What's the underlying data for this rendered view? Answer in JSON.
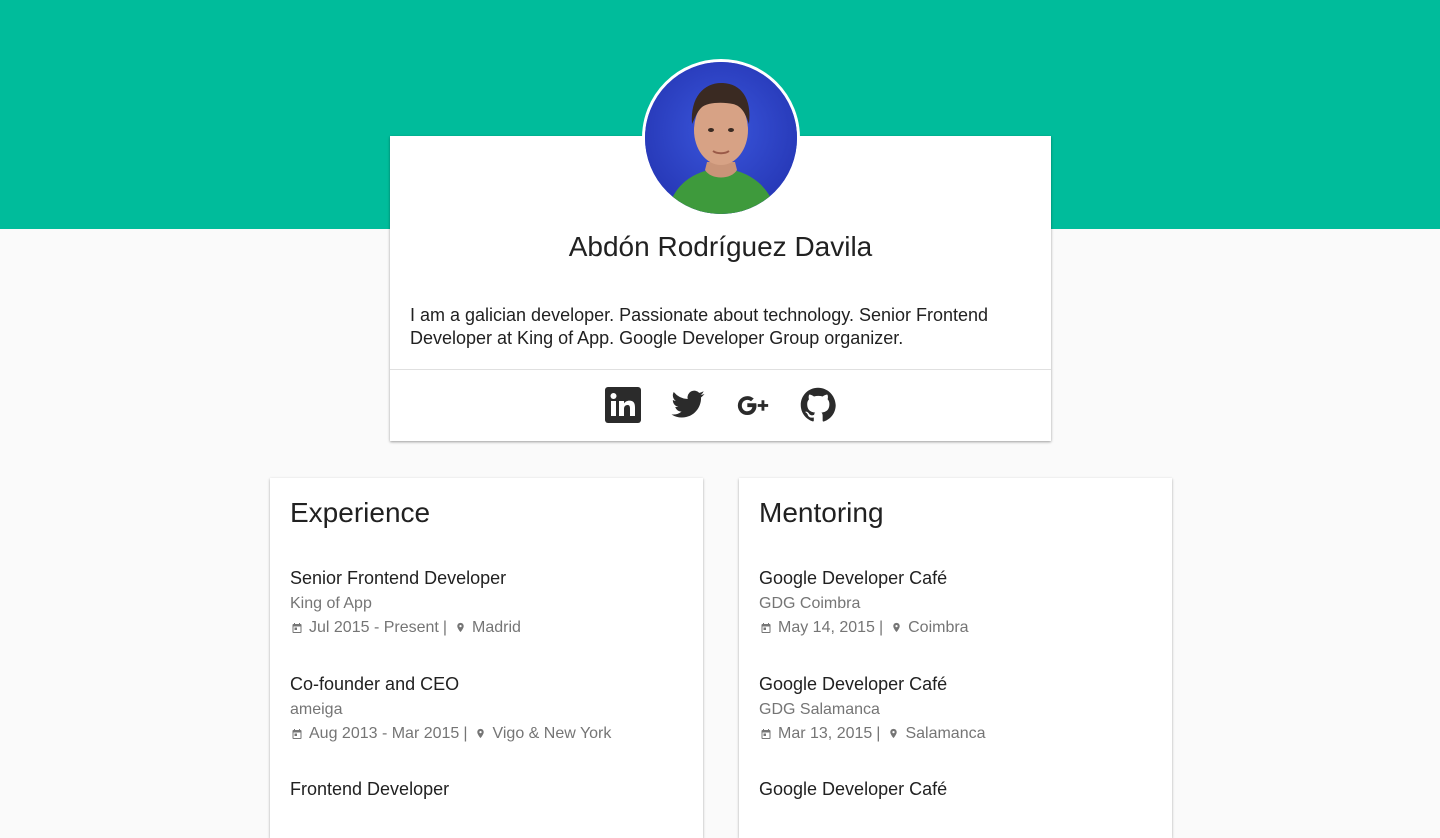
{
  "profile": {
    "name": "Abdón Rodríguez Davila",
    "bio": "I am a galician developer. Passionate about technology. Senior Frontend Developer at King of App. Google Developer Group organizer.",
    "socials": [
      {
        "name": "linkedin",
        "icon": "linkedin-icon"
      },
      {
        "name": "twitter",
        "icon": "twitter-icon"
      },
      {
        "name": "google-plus",
        "icon": "google-plus-icon"
      },
      {
        "name": "github",
        "icon": "github-icon"
      }
    ]
  },
  "colors": {
    "accent": "#00bc9b",
    "background": "#fafafa",
    "text": "#212121",
    "secondary_text": "#757575"
  },
  "experience": {
    "title": "Experience",
    "items": [
      {
        "title": "Senior Frontend Developer",
        "company": "King of App",
        "dates": "Jul 2015 - Present",
        "location": "Madrid"
      },
      {
        "title": "Co-founder and CEO",
        "company": "ameiga",
        "dates": "Aug 2013 - Mar 2015",
        "location": "Vigo & New York"
      },
      {
        "title": "Frontend Developer",
        "company": "",
        "dates": "",
        "location": ""
      }
    ]
  },
  "mentoring": {
    "title": "Mentoring",
    "items": [
      {
        "title": "Google Developer Café",
        "company": "GDG Coimbra",
        "dates": "May 14, 2015",
        "location": "Coimbra"
      },
      {
        "title": "Google Developer Café",
        "company": "GDG Salamanca",
        "dates": "Mar 13, 2015",
        "location": "Salamanca"
      },
      {
        "title": "Google Developer Café",
        "company": "",
        "dates": "",
        "location": ""
      }
    ]
  },
  "meta_separator": "|"
}
